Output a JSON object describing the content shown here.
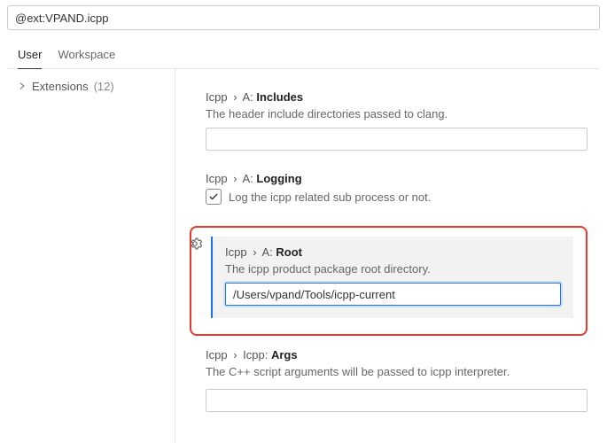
{
  "search": {
    "value": "@ext:VPAND.icpp"
  },
  "tabs": {
    "user": "User",
    "workspace": "Workspace"
  },
  "sidebar": {
    "extensions_label": "Extensions",
    "extensions_count": "(12)"
  },
  "settings": {
    "includes": {
      "crumb1": "Icpp",
      "crumb2": "A:",
      "last": "Includes",
      "desc": "The header include directories passed to clang.",
      "value": ""
    },
    "logging": {
      "crumb1": "Icpp",
      "crumb2": "A:",
      "last": "Logging",
      "desc": "Log the icpp related sub process or not.",
      "checked": true
    },
    "root": {
      "crumb1": "Icpp",
      "crumb2": "A:",
      "last": "Root",
      "desc": "The icpp product package root directory.",
      "value": "/Users/vpand/Tools/icpp-current"
    },
    "args": {
      "crumb1": "Icpp",
      "crumb2": "Icpp:",
      "last": "Args",
      "desc": "The C++ script arguments will be passed to icpp interpreter.",
      "value": ""
    }
  }
}
